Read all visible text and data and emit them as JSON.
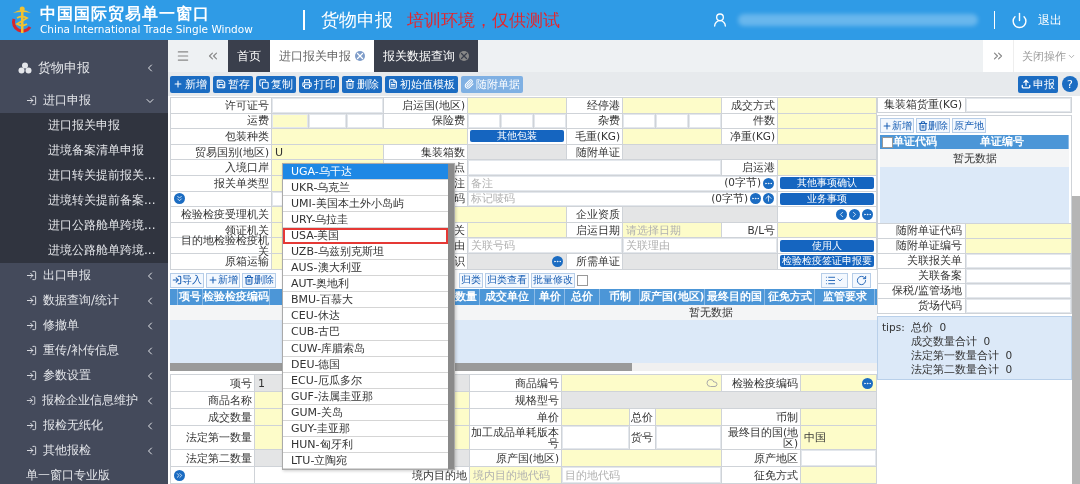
{
  "header": {
    "title": "中国国际贸易单一窗口",
    "subtitle": "China International Trade Single Window",
    "module": "货物申报",
    "notice": "培训环境，仅供测试",
    "logout": "退出"
  },
  "sidebar": {
    "title": "货物申报",
    "groups": [
      {
        "label": "进口申报",
        "expanded": true,
        "children": [
          {
            "label": "进口报关申报"
          },
          {
            "label": "进境备案清单申报"
          },
          {
            "label": "进口转关提前报关..."
          },
          {
            "label": "进境转关提前备案..."
          },
          {
            "label": "进口公路舱单跨境..."
          },
          {
            "label": "进境公路舱单跨境..."
          }
        ]
      },
      {
        "label": "出口申报",
        "expanded": false
      },
      {
        "label": "数据查询/统计",
        "expanded": false
      },
      {
        "label": "修撤单",
        "expanded": false
      },
      {
        "label": "重传/补传信息",
        "expanded": false
      },
      {
        "label": "参数设置",
        "expanded": false
      },
      {
        "label": "报检企业信息维护",
        "expanded": false
      },
      {
        "label": "报检无纸化",
        "expanded": false
      },
      {
        "label": "其他报检",
        "expanded": false
      }
    ],
    "footer": "单一窗口专业版"
  },
  "tabs": [
    {
      "label": "首页",
      "selected": false,
      "closable": false
    },
    {
      "label": "进口报关申报",
      "selected": true,
      "closable": true
    },
    {
      "label": "报关数据查询",
      "selected": false,
      "closable": true
    }
  ],
  "close_menu": "关闭操作",
  "toolbar": {
    "buttons": [
      {
        "label": "新增",
        "kind": "add",
        "disabled": false
      },
      {
        "label": "暂存",
        "kind": "save",
        "disabled": false
      },
      {
        "label": "复制",
        "kind": "copy",
        "disabled": false
      },
      {
        "label": "打印",
        "kind": "print",
        "disabled": false
      },
      {
        "label": "删除",
        "kind": "delete",
        "disabled": false
      },
      {
        "label": "初始值模板",
        "kind": "template",
        "disabled": false
      },
      {
        "label": "随附单据",
        "kind": "attachment",
        "disabled": true
      }
    ],
    "submit": "申报",
    "help": "?"
  },
  "form": {
    "rows": [
      [
        {
          "kind": "label",
          "text": "许可证号"
        },
        {
          "kind": "field",
          "required": false,
          "readonly": false
        },
        {
          "kind": "label",
          "text": "启运国(地区)"
        },
        {
          "kind": "field",
          "required": true,
          "readonly": false
        },
        {
          "kind": "label",
          "text": "经停港"
        },
        {
          "kind": "field",
          "required": true,
          "readonly": false
        },
        {
          "kind": "label",
          "text": "成交方式"
        },
        {
          "kind": "field",
          "required": true,
          "readonly": false
        }
      ],
      [
        {
          "kind": "label",
          "text": "运费"
        },
        {
          "kind": "segmented",
          "required": true
        },
        {
          "kind": "label",
          "text": "保险费"
        },
        {
          "kind": "segmented",
          "required": false
        },
        {
          "kind": "label",
          "text": "杂费"
        },
        {
          "kind": "segmented",
          "required": false
        },
        {
          "kind": "label",
          "text": "件数"
        },
        {
          "kind": "field",
          "required": true,
          "readonly": false
        }
      ],
      [
        {
          "kind": "label",
          "text": "包装种类"
        },
        {
          "kind": "field",
          "required": true,
          "readonly": false
        },
        {
          "kind": "span"
        },
        {
          "kind": "button",
          "text": "其他包装"
        },
        {
          "kind": "label",
          "text": "毛重(KG)"
        },
        {
          "kind": "field",
          "required": true,
          "readonly": false
        },
        {
          "kind": "label",
          "text": "净重(KG)"
        },
        {
          "kind": "field",
          "required": true,
          "readonly": false
        }
      ],
      [
        {
          "kind": "label",
          "text": "贸易国别(地区)"
        },
        {
          "kind": "field",
          "required": true,
          "readonly": false,
          "value": "U"
        },
        {
          "kind": "label",
          "text": "集装箱数"
        },
        {
          "kind": "field",
          "readonly": true
        },
        {
          "kind": "label",
          "text": "随附单证"
        },
        {
          "kind": "field",
          "readonly": true
        },
        {
          "kind": "span"
        },
        {
          "kind": "span"
        }
      ],
      [
        {
          "kind": "label",
          "text": "入境口岸"
        },
        {
          "kind": "field",
          "required": true,
          "readonly": false
        },
        {
          "kind": "label",
          "text": "点"
        },
        {
          "kind": "field",
          "required": false,
          "readonly": false
        },
        {
          "kind": "span"
        },
        {
          "kind": "span"
        },
        {
          "kind": "label",
          "text": "启运港"
        },
        {
          "kind": "field",
          "required": true,
          "readonly": false
        }
      ],
      [
        {
          "kind": "label",
          "text": "报关单类型"
        },
        {
          "kind": "field",
          "required": true,
          "readonly": false
        },
        {
          "kind": "label",
          "text": "注"
        },
        {
          "kind": "note",
          "placeholder": "备注",
          "count": "(0字节)",
          "attach": false
        },
        {
          "kind": "span"
        },
        {
          "kind": "span"
        },
        {
          "kind": "span"
        },
        {
          "kind": "button",
          "text": "其他事项确认"
        }
      ],
      [
        {
          "kind": "toggle",
          "expanded": false
        },
        {
          "kind": "field",
          "required": false,
          "readonly": false
        },
        {
          "kind": "label",
          "text": "码"
        },
        {
          "kind": "note",
          "placeholder": "标记唛码",
          "count": "(0字节)",
          "attach": true
        },
        {
          "kind": "span"
        },
        {
          "kind": "span"
        },
        {
          "kind": "span"
        },
        {
          "kind": "button",
          "text": "业务事项"
        }
      ],
      [
        {
          "kind": "label",
          "text": "检验检疫受理机关"
        },
        {
          "kind": "field",
          "required": true,
          "readonly": false
        },
        {
          "kind": "span"
        },
        {
          "kind": "span"
        },
        {
          "kind": "label",
          "text": "企业资质"
        },
        {
          "kind": "field",
          "readonly": true
        },
        {
          "kind": "span"
        },
        {
          "kind": "nav"
        }
      ],
      [
        {
          "kind": "label",
          "text": "领证机关"
        },
        {
          "kind": "field",
          "required": true,
          "readonly": false
        },
        {
          "kind": "label",
          "text": "关"
        },
        {
          "kind": "field",
          "required": true,
          "readonly": false
        },
        {
          "kind": "label",
          "text": "启运日期"
        },
        {
          "kind": "field",
          "required": true,
          "readonly": false,
          "placeholder": "请选择日期"
        },
        {
          "kind": "label",
          "text": "B/L号"
        },
        {
          "kind": "field",
          "required": true,
          "readonly": false
        }
      ],
      [
        {
          "kind": "label",
          "text": "目的地检验检疫机关"
        },
        {
          "kind": "field",
          "required": true,
          "readonly": false
        },
        {
          "kind": "label",
          "text": "由"
        },
        {
          "kind": "field",
          "required": false,
          "readonly": false,
          "placeholder": "关联号码"
        },
        {
          "kind": "span"
        },
        {
          "kind": "field",
          "required": false,
          "readonly": false,
          "placeholder": "关联理由"
        },
        {
          "kind": "span"
        },
        {
          "kind": "button",
          "text": "使用人"
        }
      ],
      [
        {
          "kind": "label",
          "text": "原箱运输"
        },
        {
          "kind": "field",
          "required": true,
          "readonly": false
        },
        {
          "kind": "label",
          "text": "识"
        },
        {
          "kind": "field",
          "readonly": true,
          "lookup": true
        },
        {
          "kind": "label",
          "text": "所需单证"
        },
        {
          "kind": "field",
          "readonly": true
        },
        {
          "kind": "span"
        },
        {
          "kind": "button",
          "text": "检验检疫签证申报要"
        }
      ]
    ]
  },
  "dropdown": {
    "items": [
      {
        "text": "UGA-乌干达",
        "selected": true,
        "outlined": false
      },
      {
        "text": "UKR-乌克兰",
        "selected": false,
        "outlined": false
      },
      {
        "text": "UMI-美国本土外小岛屿",
        "selected": false,
        "outlined": false
      },
      {
        "text": "URY-乌拉圭",
        "selected": false,
        "outlined": false
      },
      {
        "text": "USA-美国",
        "selected": false,
        "outlined": true
      },
      {
        "text": "UZB-乌兹别克斯坦",
        "selected": false,
        "outlined": false
      },
      {
        "text": "AUS-澳大利亚",
        "selected": false,
        "outlined": false
      },
      {
        "text": "AUT-奥地利",
        "selected": false,
        "outlined": false
      },
      {
        "text": "BMU-百慕大",
        "selected": false,
        "outlined": false
      },
      {
        "text": "CEU-休达",
        "selected": false,
        "outlined": false
      },
      {
        "text": "CUB-古巴",
        "selected": false,
        "outlined": false
      },
      {
        "text": "CUW-库腊索岛",
        "selected": false,
        "outlined": false
      },
      {
        "text": "DEU-德国",
        "selected": false,
        "outlined": false
      },
      {
        "text": "ECU-厄瓜多尔",
        "selected": false,
        "outlined": false
      },
      {
        "text": "GUF-法属圭亚那",
        "selected": false,
        "outlined": false
      },
      {
        "text": "GUM-关岛",
        "selected": false,
        "outlined": false
      },
      {
        "text": "GUY-圭亚那",
        "selected": false,
        "outlined": false
      },
      {
        "text": "HUN-匈牙利",
        "selected": false,
        "outlined": false
      },
      {
        "text": "LTU-立陶宛",
        "selected": false,
        "outlined": false
      }
    ]
  },
  "goods_list": {
    "toolbar": [
      {
        "label": "导入",
        "kind": "import"
      },
      {
        "label": "新增",
        "kind": "add"
      },
      {
        "label": "删除",
        "kind": "delete"
      },
      {
        "label": "归类",
        "kind": "plain"
      },
      {
        "label": "归类查看",
        "kind": "plain"
      },
      {
        "label": "批量修改",
        "kind": "plain"
      }
    ],
    "select_all": {
      "checked": false
    },
    "columns": [
      "项号",
      "检验检疫编码",
      "数量",
      "成交单位",
      "单价",
      "总价",
      "币制",
      "原产国(地区)",
      "最终目的国",
      "征免方式",
      "监管要求"
    ],
    "empty": "暂无数据"
  },
  "item_form": {
    "rows": [
      [
        {
          "kind": "label",
          "text": "项号"
        },
        {
          "kind": "field",
          "readonly": true,
          "value": "1"
        },
        {
          "kind": "label",
          "text": "商品编号"
        },
        {
          "kind": "field",
          "required": true,
          "readonly": false,
          "cloud": true
        },
        {
          "kind": "span"
        },
        {
          "kind": "span"
        },
        {
          "kind": "label",
          "text": "检验检疫编码"
        },
        {
          "kind": "field",
          "required": true,
          "readonly": false,
          "lookup": true
        }
      ],
      [
        {
          "kind": "label",
          "text": "商品名称"
        },
        {
          "kind": "field",
          "required": true,
          "readonly": false
        },
        {
          "kind": "label",
          "text": "规格型号"
        },
        {
          "kind": "field",
          "readonly": true
        },
        {
          "kind": "span"
        },
        {
          "kind": "span"
        },
        {
          "kind": "span"
        },
        {
          "kind": "span"
        }
      ],
      [
        {
          "kind": "label",
          "text": "成交数量"
        },
        {
          "kind": "field",
          "required": true,
          "readonly": false
        },
        {
          "kind": "label",
          "text": "单价"
        },
        {
          "kind": "field",
          "required": true,
          "readonly": false
        },
        {
          "kind": "label",
          "text": "总价"
        },
        {
          "kind": "field",
          "required": true,
          "readonly": false
        },
        {
          "kind": "label",
          "text": "币制"
        },
        {
          "kind": "field",
          "required": true,
          "readonly": false
        }
      ],
      [
        {
          "kind": "label",
          "text": "法定第一数量"
        },
        {
          "kind": "field",
          "required": true,
          "readonly": false
        },
        {
          "kind": "label",
          "text": "加工成品单耗版本号"
        },
        {
          "kind": "field",
          "required": false,
          "readonly": false
        },
        {
          "kind": "label",
          "text": "货号"
        },
        {
          "kind": "field",
          "required": false,
          "readonly": false
        },
        {
          "kind": "label",
          "text": "最终目的国(地区)"
        },
        {
          "kind": "field",
          "required": true,
          "readonly": false,
          "value": "中国"
        }
      ],
      [
        {
          "kind": "label",
          "text": "法定第二数量"
        },
        {
          "kind": "field",
          "readonly": true
        },
        {
          "kind": "label",
          "text": "原产国(地区)"
        },
        {
          "kind": "field",
          "required": true,
          "readonly": false
        },
        {
          "kind": "span"
        },
        {
          "kind": "span"
        },
        {
          "kind": "label",
          "text": "原产地区"
        },
        {
          "kind": "field",
          "required": false,
          "readonly": false
        }
      ],
      [
        {
          "kind": "toggle",
          "expanded": false
        },
        {
          "kind": "label",
          "text": "境内目的地"
        },
        {
          "kind": "field",
          "required": true,
          "readonly": false,
          "placeholder": "境内目的地代码"
        },
        {
          "kind": "field",
          "required": false,
          "readonly": false,
          "placeholder": "目的地代码"
        },
        {
          "kind": "span"
        },
        {
          "kind": "span"
        },
        {
          "kind": "label",
          "text": "征免方式"
        },
        {
          "kind": "field",
          "required": true,
          "readonly": false
        }
      ]
    ]
  },
  "side_panel": {
    "container_weight": {
      "label": "集装箱货重(KG)",
      "required": false
    },
    "toolbar": [
      {
        "label": "新增",
        "kind": "add"
      },
      {
        "label": "删除",
        "kind": "delete"
      },
      {
        "label": "原产地",
        "kind": "plain"
      }
    ],
    "select_all": {
      "checked": false
    },
    "columns": [
      "单证代码",
      "单证编号"
    ],
    "empty": "暂无数据",
    "fields": [
      {
        "label": "随附单证代码",
        "required": true
      },
      {
        "label": "随附单证编号",
        "required": true
      },
      {
        "label": "关联报关单",
        "required": false
      },
      {
        "label": "关联备案",
        "required": false
      },
      {
        "label": "保税/监管场地",
        "required": false
      },
      {
        "label": "货场代码",
        "required": false
      }
    ],
    "tips": {
      "label": "tips:",
      "lines": [
        "总价  0",
        "成交数量合计  0",
        "法定第一数量合计  0",
        "法定第二数量合计  0"
      ]
    }
  }
}
